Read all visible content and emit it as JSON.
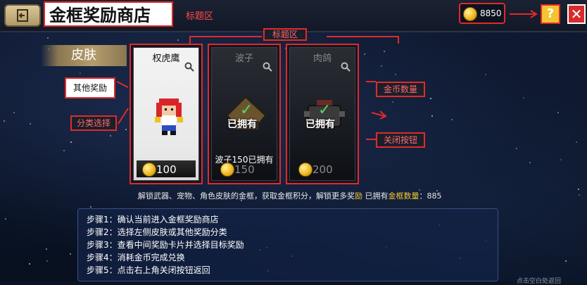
{
  "header": {
    "title": "金框奖励商店",
    "title_annotation": "标题区",
    "coins": "8850"
  },
  "annotations": {
    "title_area_center": "标题区",
    "other_rewards": "其他奖励",
    "category_select": "分类选择",
    "coin_amount": "金币数量",
    "close_button": "关闭按钮"
  },
  "sidebar": {
    "active_category": "皮肤"
  },
  "cards": [
    {
      "name": "权虎鹰",
      "price": "100",
      "owned": false,
      "owned_label": "",
      "owned_note": ""
    },
    {
      "name": "波子",
      "price": "150",
      "owned": true,
      "owned_label": "已拥有",
      "owned_note": "波子150已拥有"
    },
    {
      "name": "肉鸽",
      "price": "200",
      "owned": true,
      "owned_label": "已拥有",
      "owned_note": ""
    }
  ],
  "info": {
    "prefix": "解锁武器、宠物、角色皮肤的金框，获取金框积分，解锁更多奖",
    "highlight1": "励",
    "mid": " 已拥有",
    "highlight2": "金框数量",
    "suffix": "：885"
  },
  "steps": [
    "步骤1：确认当前进入金框奖励商店",
    "步骤2：选择左侧皮肤或其他奖励分类",
    "步骤3：查看中间奖励卡片并选择目标奖励",
    "步骤4：消耗金币完成兑换",
    "步骤5：点击右上角关闭按钮返回"
  ],
  "corner_text": "点击空白处返回",
  "icons": {
    "back": "back-arrow-icon",
    "coin": "coin-icon",
    "help": "help-icon",
    "close": "close-icon",
    "zoom": "zoom-icon",
    "check": "check-icon"
  },
  "colors": {
    "annotation_red": "#e02a2a",
    "gold": "#f2c531",
    "close_red": "#d62c2c"
  }
}
